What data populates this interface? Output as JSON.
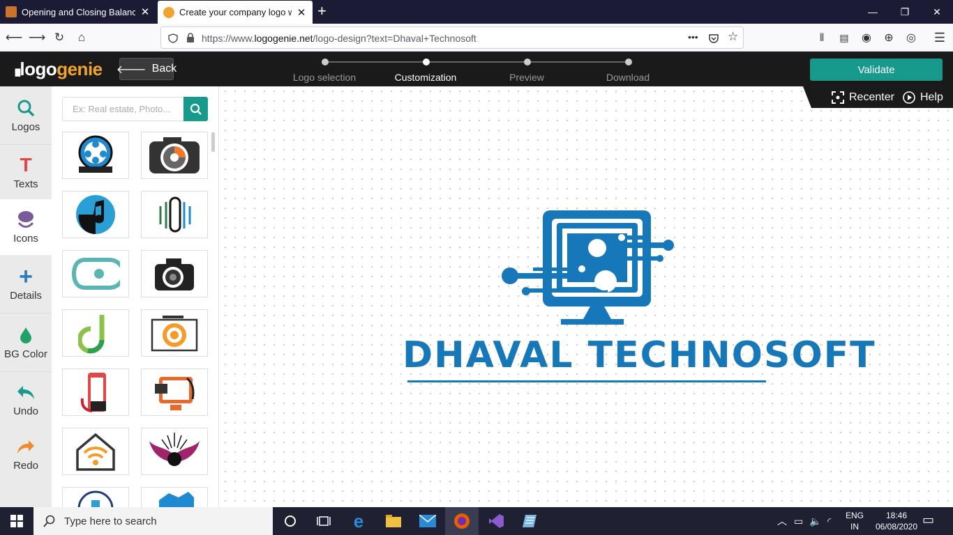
{
  "browser": {
    "tabs": [
      {
        "title": "Opening and Closing Balance -",
        "active": false
      },
      {
        "title": "Create your company logo with",
        "active": true
      }
    ],
    "new_tab": "+",
    "url_prefix": "https://www.",
    "url_domain": "logogenie.net",
    "url_path": "/logo-design?text=Dhaval+Technosoft",
    "page_actions": "•••"
  },
  "app": {
    "brand_left": "logo",
    "brand_right": "genie",
    "back_label": "Back",
    "steps": [
      {
        "label": "Logo selection",
        "active": false
      },
      {
        "label": "Customization",
        "active": true
      },
      {
        "label": "Preview",
        "active": false
      },
      {
        "label": "Download",
        "active": false
      }
    ],
    "validate_label": "Validate",
    "recenter_label": "Recenter",
    "help_label": "Help"
  },
  "sidebar": {
    "items": [
      {
        "label": "Logos",
        "icon": "search-icon",
        "active": false
      },
      {
        "label": "Texts",
        "icon": "text-t-icon",
        "active": false
      },
      {
        "label": "Icons",
        "icon": "icons-icon",
        "active": true
      },
      {
        "label": "Details",
        "icon": "plus-icon",
        "active": false
      },
      {
        "label": "BG Color",
        "icon": "drop-icon",
        "active": false
      },
      {
        "label": "Undo",
        "icon": "undo-icon",
        "active": false
      },
      {
        "label": "Redo",
        "icon": "redo-icon",
        "active": false
      }
    ]
  },
  "icon_panel": {
    "search_placeholder": "Ex: Real estate, Photo...",
    "thumbnails": [
      "film-reel-icon",
      "camera-aperture-icon",
      "music-note-icon",
      "microphone-lines-icon",
      "speech-bubble-icon",
      "slr-camera-icon",
      "letter-d-icon",
      "camera-frame-icon",
      "smartphone-icon",
      "computer-monitor-icon",
      "smart-home-wifi-icon",
      "winged-emblem-icon"
    ]
  },
  "canvas": {
    "company_name": "DHAVAL TECHNOSOFT",
    "logo_icon": "computer-circuit-icon",
    "brand_color": "#1678b9"
  },
  "taskbar": {
    "search_placeholder": "Type here to search",
    "lang_top": "ENG",
    "lang_bottom": "IN",
    "time": "18:46",
    "date": "06/08/2020"
  }
}
